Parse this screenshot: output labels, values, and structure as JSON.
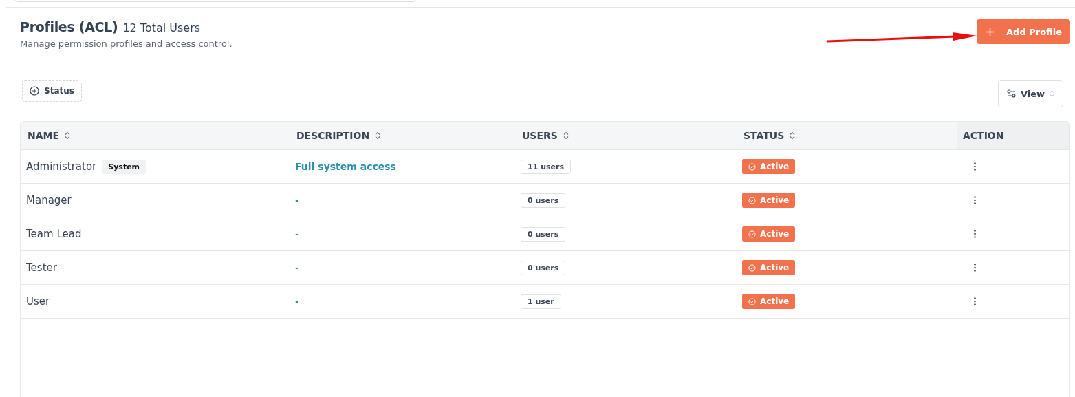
{
  "header": {
    "title": "Profiles (ACL)",
    "count": "12 Total Users",
    "subtitle": "Manage permission profiles and access control.",
    "add_button": "Add Profile"
  },
  "filters": {
    "status_button": "Status",
    "view_button": "View"
  },
  "table": {
    "columns": [
      {
        "label": "NAME",
        "sortable": true
      },
      {
        "label": "DESCRIPTION",
        "sortable": true
      },
      {
        "label": "USERS",
        "sortable": true
      },
      {
        "label": "STATUS",
        "sortable": true
      },
      {
        "label": "ACTION",
        "sortable": false
      }
    ],
    "rows": [
      {
        "name": "Administrator",
        "tag": "System",
        "description": "Full system access",
        "users": "11 users",
        "status": "Active"
      },
      {
        "name": "Manager",
        "description": "-",
        "users": "0 users",
        "status": "Active"
      },
      {
        "name": "Team Lead",
        "description": "-",
        "users": "0 users",
        "status": "Active"
      },
      {
        "name": "Tester",
        "description": "-",
        "users": "0 users",
        "status": "Active"
      },
      {
        "name": "User",
        "description": "-",
        "users": "1 user",
        "status": "Active"
      }
    ]
  }
}
